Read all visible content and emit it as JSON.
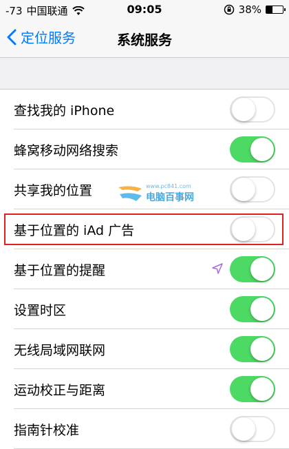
{
  "status_bar": {
    "signal": "-73",
    "carrier": "中国联通",
    "time": "09:05",
    "battery": "38%",
    "battery_level": 0.38
  },
  "nav": {
    "back_label": "定位服务",
    "title": "系统服务"
  },
  "rows": [
    {
      "label": "查找我的 iPhone",
      "on": false
    },
    {
      "label": "蜂窝移动网络搜索",
      "on": true
    },
    {
      "label": "共享我的位置",
      "on": false
    },
    {
      "label": "基于位置的 iAd 广告",
      "on": false
    },
    {
      "label": "基于位置的提醒",
      "on": true
    },
    {
      "label": "设置时区",
      "on": true
    },
    {
      "label": "无线局域网联网",
      "on": true
    },
    {
      "label": "运动校正与距离",
      "on": true
    },
    {
      "label": "指南针校准",
      "on": false
    }
  ],
  "watermark": {
    "url": "www.pc841.com",
    "text": "电脑百事网"
  },
  "colors": {
    "accent": "#007aff",
    "toggle_on": "#4cd964",
    "highlight": "#e02020",
    "location_arrow": "#a56dd6"
  }
}
